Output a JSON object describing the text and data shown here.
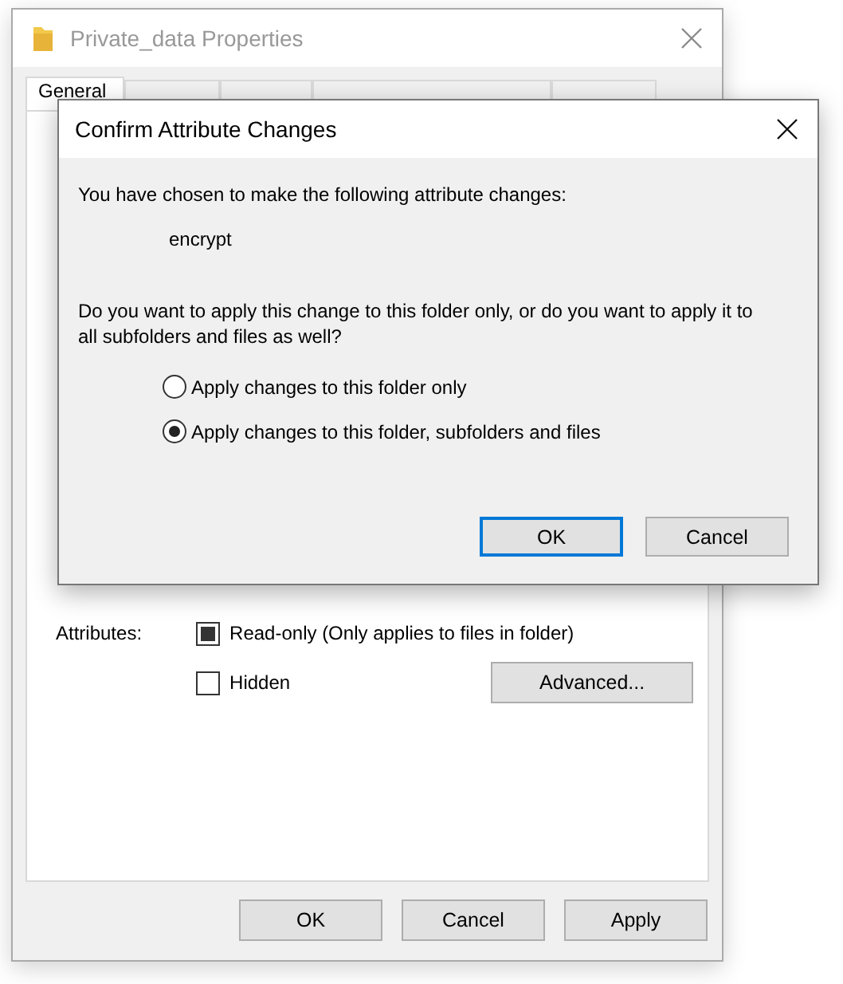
{
  "properties_window": {
    "title": "Private_data Properties",
    "tabs": [
      {
        "label": "General",
        "selected": true
      },
      {
        "selected": false
      },
      {
        "selected": false
      },
      {
        "selected": false
      },
      {
        "selected": false
      }
    ],
    "attributes_label": "Attributes:",
    "attributes": [
      {
        "label": "Read-only (Only applies to files in folder)",
        "indeterminate": true
      },
      {
        "label": "Hidden",
        "indeterminate": false
      }
    ],
    "advanced_button": "Advanced...",
    "buttons": [
      "OK",
      "Cancel",
      "Apply"
    ]
  },
  "dialog": {
    "title": "Confirm Attribute Changes",
    "intro": "You have chosen to make the following attribute changes:",
    "change": "encrypt",
    "question": "Do you want to apply this change to this folder only, or do you want to apply it to all subfolders and files as well?",
    "options": [
      {
        "label": "Apply changes to this folder only",
        "selected": false
      },
      {
        "label": "Apply changes to this folder, subfolders and files",
        "selected": true
      }
    ],
    "buttons": [
      {
        "label": "OK",
        "default": true
      },
      {
        "label": "Cancel",
        "default": false
      }
    ]
  }
}
